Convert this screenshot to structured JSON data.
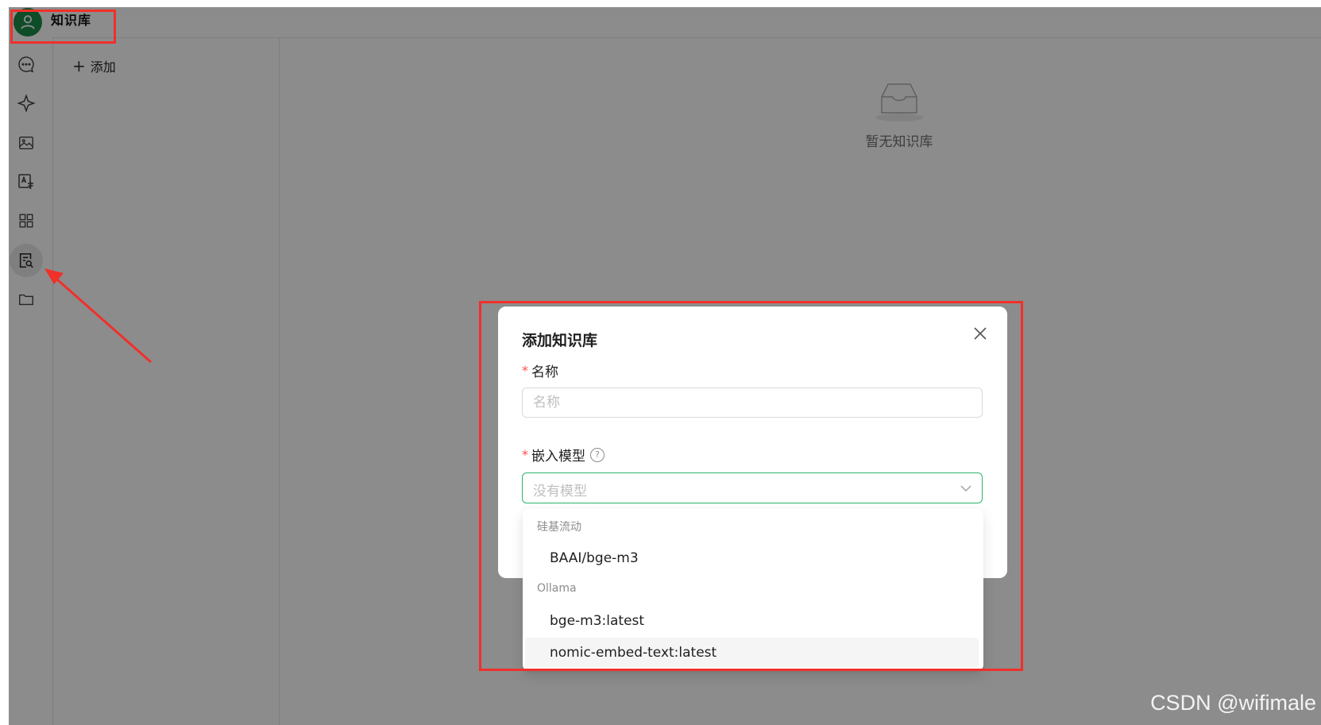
{
  "header": {
    "title": "知识库"
  },
  "rail": {
    "items": [
      {
        "icon": "chat-bubble-icon"
      },
      {
        "icon": "sparkle-icon"
      },
      {
        "icon": "image-icon"
      },
      {
        "icon": "translate-icon"
      },
      {
        "icon": "apps-grid-icon"
      },
      {
        "icon": "knowledge-base-icon",
        "active": true
      },
      {
        "icon": "folder-icon"
      }
    ]
  },
  "list": {
    "add_label": "添加"
  },
  "main": {
    "empty_text": "暂无知识库"
  },
  "modal": {
    "title": "添加知识库",
    "required_mark": "*",
    "name_label": "名称",
    "name_placeholder": "名称",
    "name_value": "",
    "model_label": "嵌入模型",
    "model_help_glyph": "?",
    "model_placeholder": "没有模型"
  },
  "dropdown": {
    "groups": [
      {
        "label": "硅基流动",
        "options": [
          "BAAI/bge-m3"
        ]
      },
      {
        "label": "Ollama",
        "options": [
          "bge-m3:latest",
          "nomic-embed-text:latest"
        ]
      }
    ],
    "hovered_option": "nomic-embed-text:latest"
  },
  "watermark": "CSDN @wifimale",
  "colors": {
    "accent": "#2fb46b",
    "avatar": "#1c8a4a",
    "required": "#ff4d4f",
    "annotation": "#f0302a",
    "mask": "rgba(0,0,0,0.45)"
  }
}
